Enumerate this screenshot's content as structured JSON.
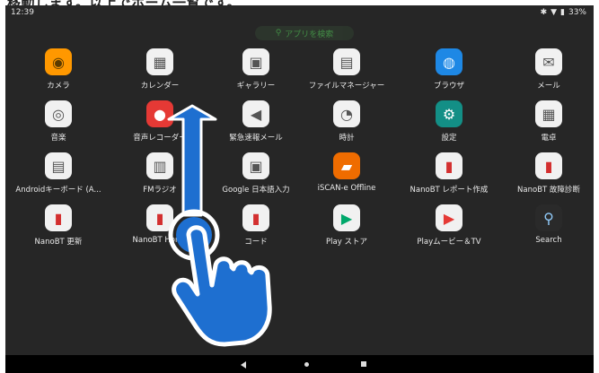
{
  "caption": "移動します。以上でホーム一覧です。",
  "status": {
    "time": "12:39",
    "battery": "33%"
  },
  "search": {
    "label": "アプリを検索"
  },
  "apps": [
    {
      "label": "カメラ",
      "icon": "camera-icon",
      "bg": "#ff9800"
    },
    {
      "label": "カレンダー",
      "icon": "calendar-icon",
      "bg": "#f1f1f1"
    },
    {
      "label": "ギャラリー",
      "icon": "gallery-icon",
      "bg": "#f1f1f1"
    },
    {
      "label": "ファイルマネージャー",
      "icon": "file-manager-icon",
      "bg": "#f1f1f1"
    },
    {
      "label": "ブラウザ",
      "icon": "browser-icon",
      "bg": "#1e88e5"
    },
    {
      "label": "メール",
      "icon": "mail-icon",
      "bg": "#f1f1f1"
    },
    {
      "label": "音楽",
      "icon": "music-icon",
      "bg": "#f1f1f1"
    },
    {
      "label": "音声レコーダー",
      "icon": "voice-recorder-icon",
      "bg": "#e53935"
    },
    {
      "label": "緊急速報メール",
      "icon": "emergency-alert-icon",
      "bg": "#f1f1f1"
    },
    {
      "label": "時計",
      "icon": "clock-icon",
      "bg": "#f1f1f1"
    },
    {
      "label": "設定",
      "icon": "settings-icon",
      "bg": "#138f86"
    },
    {
      "label": "電卓",
      "icon": "calculator-icon",
      "bg": "#f1f1f1"
    },
    {
      "label": "Androidキーボード (A...",
      "icon": "keyboard-icon",
      "bg": "#f1f1f1"
    },
    {
      "label": "FMラジオ",
      "icon": "radio-icon",
      "bg": "#f1f1f1"
    },
    {
      "label": "Google 日本語入力",
      "icon": "japanese-input-icon",
      "bg": "#f1f1f1"
    },
    {
      "label": "iSCAN-e Offline",
      "icon": "iscan-icon",
      "bg": "#ef6c00"
    },
    {
      "label": "NanoBT レポート作成",
      "icon": "nanobt-report-icon",
      "bg": "#f1f1f1"
    },
    {
      "label": "NanoBT 故障診断",
      "icon": "nanobt-diagnosis-icon",
      "bg": "#f1f1f1"
    },
    {
      "label": "NanoBT 更新",
      "icon": "nanobt-update-icon",
      "bg": "#f1f1f1"
    },
    {
      "label": "NanoBT Home",
      "icon": "nanobt-home-icon",
      "bg": "#f1f1f1"
    },
    {
      "label": "コード",
      "icon": "nanobt-code-icon",
      "bg": "#f1f1f1"
    },
    {
      "label": "Play ストア",
      "icon": "play-store-icon",
      "bg": "#f1f1f1"
    },
    {
      "label": "Playムービー＆TV",
      "icon": "play-movies-icon",
      "bg": "#f1f1f1"
    },
    {
      "label": "Search",
      "icon": "search-icon",
      "bg": "#2a2a2a"
    }
  ]
}
